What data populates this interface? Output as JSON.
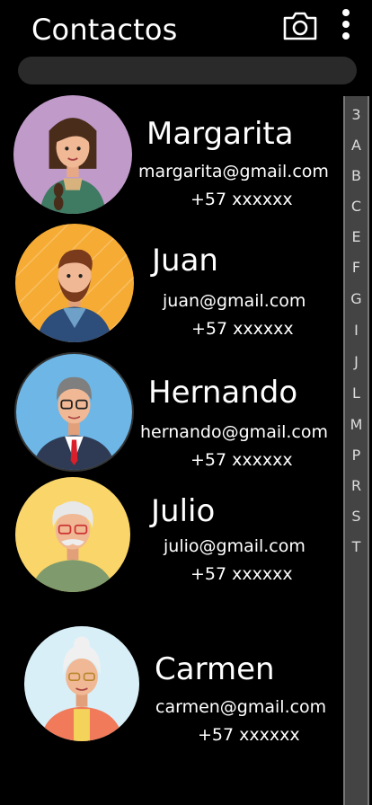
{
  "header": {
    "title": "Contactos",
    "camera_icon": "camera-icon",
    "menu_icon": "more-vertical-icon"
  },
  "search": {
    "value": ""
  },
  "alphabet": [
    "3",
    "A",
    "B",
    "C",
    "E",
    "F",
    "G",
    "I",
    "J",
    "L",
    "M",
    "P",
    "R",
    "S",
    "T"
  ],
  "contacts": [
    {
      "name": "Margarita",
      "email": "margarita@gmail.com",
      "phone": "+57 xxxxxx"
    },
    {
      "name": "Juan",
      "email": "juan@gmail.com",
      "phone": "+57 xxxxxx"
    },
    {
      "name": "Hernando",
      "email": "hernando@gmail.com",
      "phone": "+57 xxxxxx"
    },
    {
      "name": "Julio",
      "email": "julio@gmail.com",
      "phone": "+57 xxxxxx"
    },
    {
      "name": "Carmen",
      "email": "carmen@gmail.com",
      "phone": "+57 xxxxxx"
    }
  ],
  "colors": {
    "background": "#000000",
    "search": "#2a2a2a",
    "index_bar": "#444444"
  }
}
